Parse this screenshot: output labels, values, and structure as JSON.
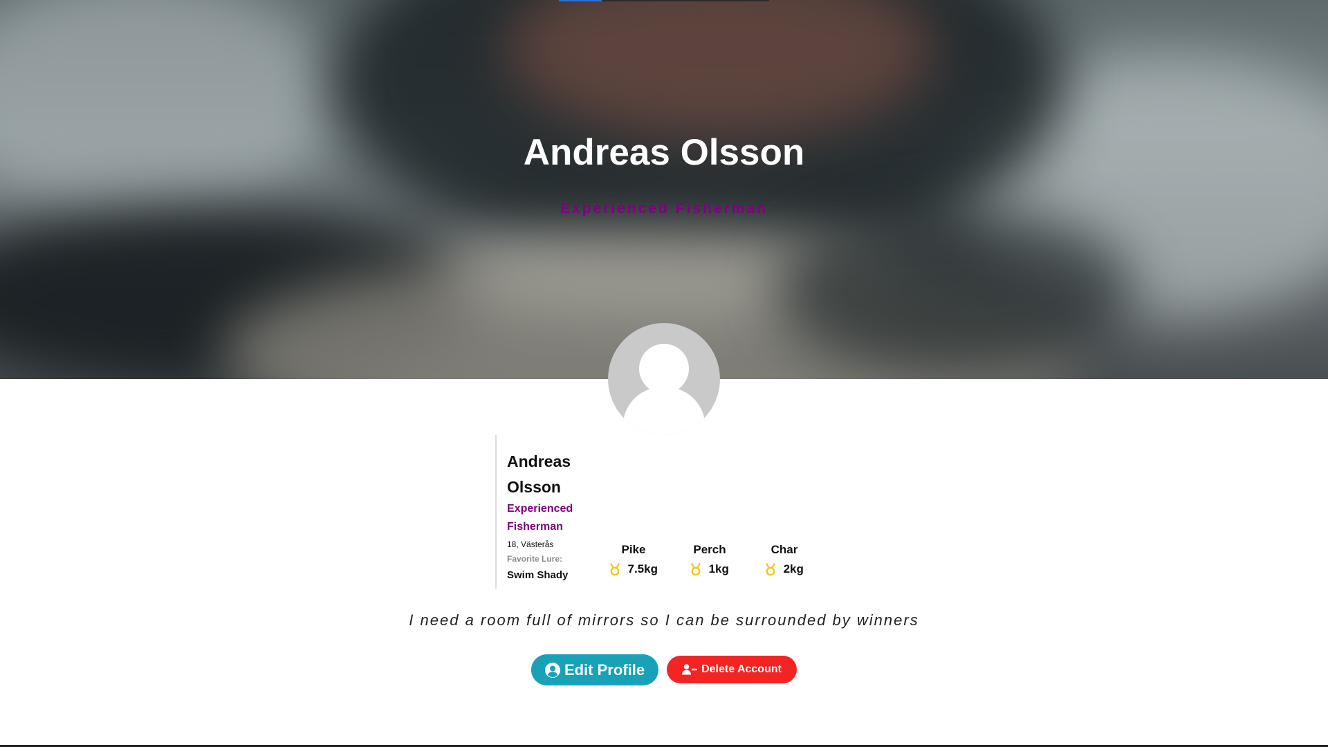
{
  "hero": {
    "title": "Andreas Olsson",
    "subtitle": "Experienced Fisherman"
  },
  "profile": {
    "first_name": "Andreas",
    "last_name": "Olsson",
    "role_line1": "Experienced",
    "role_line2": "Fisherman",
    "age_location": "18, Västerås",
    "favorite_lure_label": "Favorite Lure:",
    "favorite_lure": "Swim Shady",
    "catches": [
      {
        "species": "Pike",
        "weight": "7.5kg",
        "icon": "medal-icon"
      },
      {
        "species": "Perch",
        "weight": "1kg",
        "icon": "medal-icon"
      },
      {
        "species": "Char",
        "weight": "2kg",
        "icon": "medal-icon"
      }
    ]
  },
  "quote": "I need a room full of mirrors so I can be surrounded by winners",
  "actions": {
    "edit_label": "Edit Profile",
    "edit_icon": "user-circle-icon",
    "delete_label": "Delete Account",
    "delete_icon": "user-minus-icon"
  },
  "colors": {
    "accent_purple": "#800080",
    "edit_button": "#17a2b8",
    "delete_button": "#f32424",
    "medal": "#f5c518"
  }
}
